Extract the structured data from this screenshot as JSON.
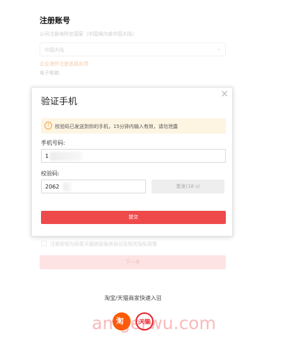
{
  "page": {
    "title": "注册账号",
    "location_label": "公司注册地所在国家（中国境内或中国大陆）",
    "location_value": "中国大陆",
    "alt_link": "企业海外注册选择此项",
    "email_label": "电子邮箱",
    "agreement_text": "注册即视为同意天猫商家服务协议及相关隐私政策",
    "next_label": "下一步",
    "quick_entry": "淘宝/天猫商家快速入驻",
    "brand_taobao": "淘",
    "brand_tmall": "天猫",
    "watermark": "amgerwu.com"
  },
  "dialog": {
    "title": "验证手机",
    "notice": "校验码已发送到你的手机，15分钟内输入有效，请勿泄露",
    "phone_label": "手机号码:",
    "phone_value": "1",
    "code_label": "校验码:",
    "code_value": "2062",
    "resend_label": "重发(18 s)",
    "submit_label": "提交",
    "close_glyph": "×",
    "notice_icon": "!"
  },
  "colors": {
    "accent": "#ee4a4b",
    "notice_bg": "#fdf4e2",
    "notice_icon": "#f0a13a"
  }
}
